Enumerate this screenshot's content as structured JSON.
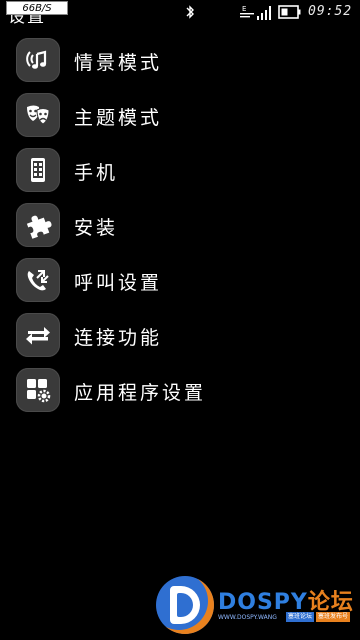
{
  "status_bar": {
    "speed": "66B/S",
    "time": "09:52"
  },
  "header": {
    "title": "设置"
  },
  "menu": [
    {
      "label": "情景模式",
      "icon": "profiles-icon"
    },
    {
      "label": "主题模式",
      "icon": "theme-masks-icon"
    },
    {
      "label": "手机",
      "icon": "phone-device-icon"
    },
    {
      "label": "安装",
      "icon": "puzzle-icon"
    },
    {
      "label": "呼叫设置",
      "icon": "call-settings-icon"
    },
    {
      "label": "连接功能",
      "icon": "connectivity-arrows-icon"
    },
    {
      "label": "应用程序设置",
      "icon": "app-settings-icon"
    }
  ],
  "watermark": {
    "brand": "DOSPY",
    "brand_cn": "论坛",
    "sub": "WWW.DOSPY.WANG",
    "tag1": "塞班论坛",
    "tag2": "塞班发布号",
    "colors": {
      "blue": "#2f6fd1",
      "orange": "#e8811e"
    }
  },
  "colors": {
    "background": "#000000",
    "tile": "#3a3a3a",
    "text": "#ffffff"
  }
}
